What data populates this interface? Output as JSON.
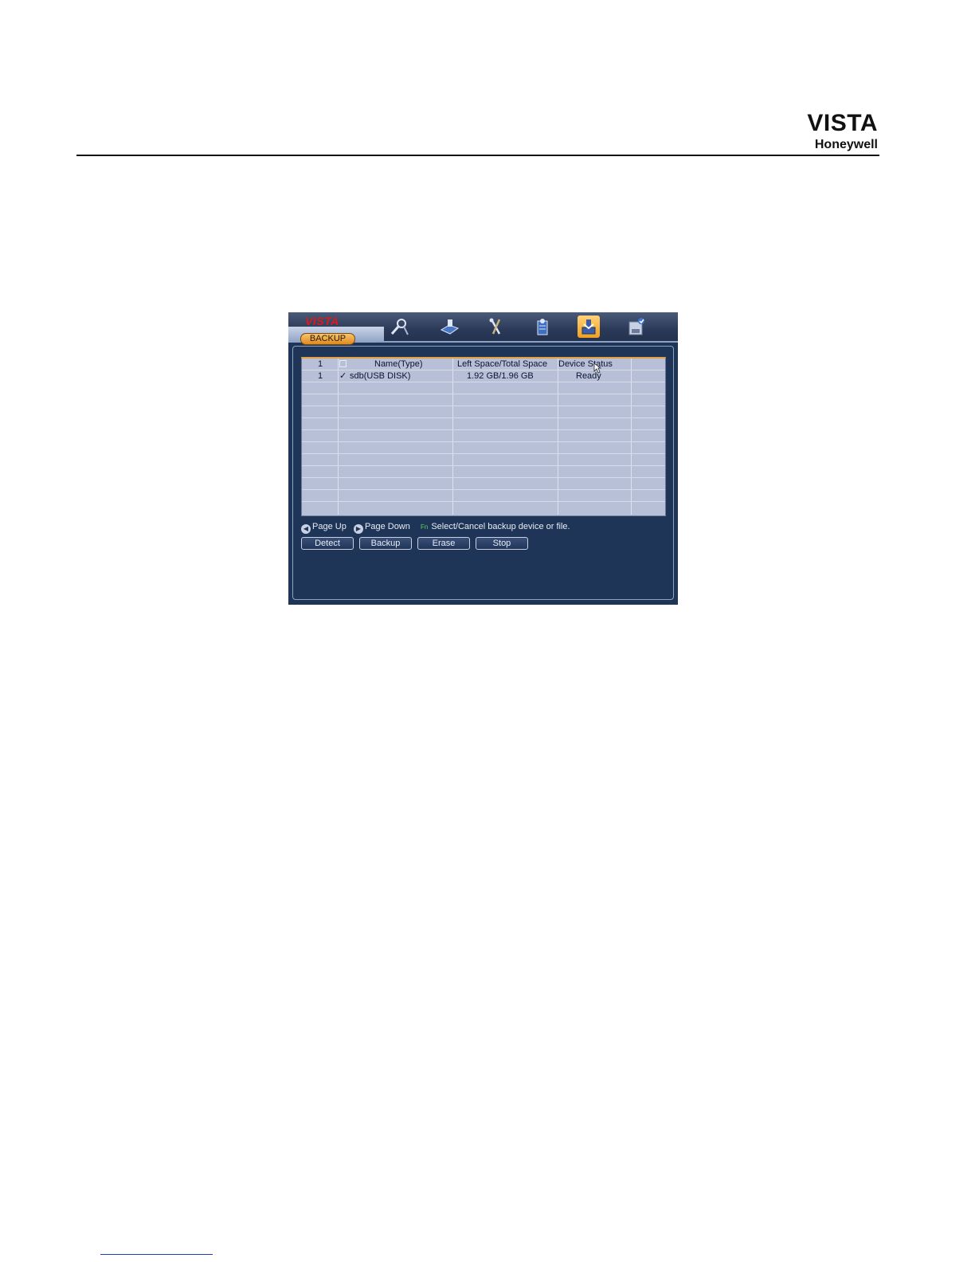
{
  "document": {
    "brand_title": "VISTA",
    "brand_subtitle": "Honeywell"
  },
  "dvr": {
    "logo": "VISTA",
    "active_tab": "BACKUP",
    "menu_icons": [
      "search-icon",
      "record-icon",
      "tools-icon",
      "info-icon",
      "backup-icon",
      "disk-icon"
    ],
    "table": {
      "header": {
        "index": "1",
        "name": "Name(Type)",
        "space": "Left Space/Total Space",
        "status": "Device Status"
      },
      "rows": [
        {
          "index": "1",
          "checked": "✓",
          "name": "sdb(USB DISK)",
          "space": "1.92 GB/1.96 GB",
          "status": "Ready"
        }
      ]
    },
    "hints": {
      "page_up": "Page Up",
      "page_down": "Page Down",
      "fn_key": "Fn",
      "select_hint": "Select/Cancel backup device or file."
    },
    "buttons": {
      "detect": "Detect",
      "backup": "Backup",
      "erase": "Erase",
      "stop": "Stop"
    }
  }
}
